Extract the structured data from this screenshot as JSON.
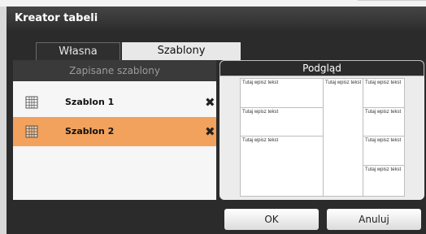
{
  "window": {
    "title": "Kreator tabeli"
  },
  "tabs": [
    {
      "label": "Własna",
      "active": false
    },
    {
      "label": "Szablony",
      "active": true
    }
  ],
  "saved": {
    "header": "Zapisane szablony",
    "items": [
      {
        "label": "Szablon 1",
        "selected": false,
        "icon": "grid-icon",
        "delete_icon": "close-icon"
      },
      {
        "label": "Szablon 2",
        "selected": true,
        "icon": "grid-icon",
        "delete_icon": "close-icon"
      }
    ]
  },
  "preview": {
    "header": "Podgląd",
    "placeholder": "Tutaj wpisz tekst"
  },
  "buttons": {
    "ok": "OK",
    "cancel": "Anuluj"
  },
  "colors": {
    "accent": "#f2a25c",
    "dark": "#2b2b2b"
  }
}
